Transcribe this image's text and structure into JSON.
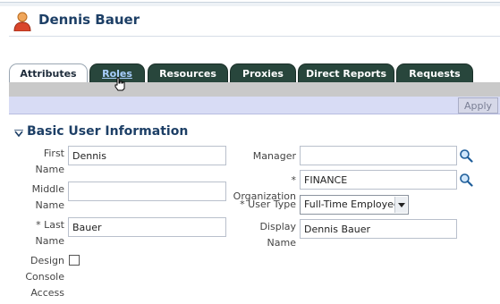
{
  "header": {
    "title": "Dennis Bauer"
  },
  "tabs": [
    {
      "label": "Attributes",
      "active": true
    },
    {
      "label": "Roles",
      "hover": true
    },
    {
      "label": "Resources"
    },
    {
      "label": "Proxies"
    },
    {
      "label": "Direct Reports"
    },
    {
      "label": "Requests"
    }
  ],
  "toolbar": {
    "apply_label": "Apply"
  },
  "section": {
    "title": "Basic User Information"
  },
  "form": {
    "first_name": {
      "label_line1": "First",
      "label_line2": "Name",
      "value": "Dennis"
    },
    "middle_name": {
      "label_line1": "Middle",
      "label_line2": "Name",
      "value": ""
    },
    "last_name": {
      "required": "*",
      "label_line1": "Last",
      "label_line2": "Name",
      "value": "Bauer"
    },
    "design_console": {
      "label_line1": "Design",
      "label_line2": "Console",
      "label_line3": "Access",
      "checked": false
    },
    "manager": {
      "label": "Manager",
      "value": ""
    },
    "organization": {
      "required": "*",
      "label": "Organization",
      "value": "FINANCE"
    },
    "user_type": {
      "required": "*",
      "label": "User Type",
      "value": "Full-Time Employee"
    },
    "display_name": {
      "label": "Display Name",
      "value": "Dennis Bauer"
    }
  },
  "colors": {
    "tab_bg": "#28463c",
    "title": "#1d3f66",
    "toolbar": "#d8dcf5"
  }
}
